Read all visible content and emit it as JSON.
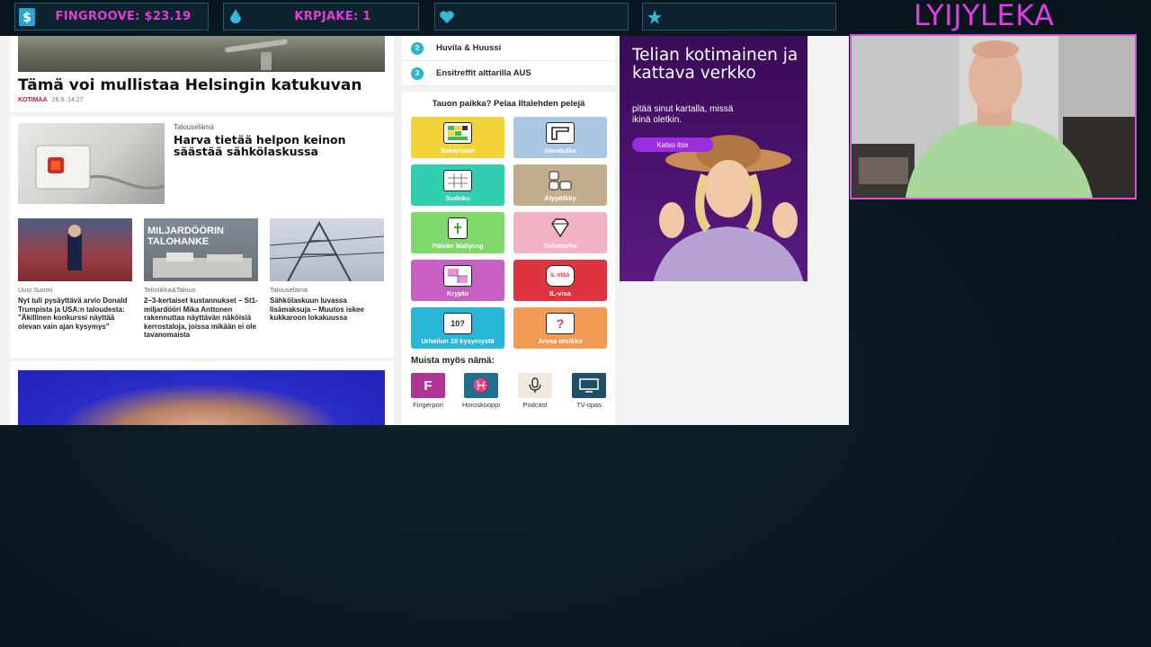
{
  "stream_bar": {
    "streamer_name": "LYIJYLEKA",
    "stats": [
      {
        "icon": "dollar-icon",
        "text": "FINGROOVE: $23.19"
      },
      {
        "icon": "droplet-icon",
        "text": "KRPJAKE: 1"
      },
      {
        "icon": "heart-icon",
        "text": ""
      },
      {
        "icon": "star-icon",
        "text": ""
      }
    ],
    "accent_color": "#e63bd8"
  },
  "news": {
    "hero": {
      "title": "Tämä voi mullistaa Helsingin katukuvan",
      "tag": "KOTIMAA",
      "time": "26.8. 14:27"
    },
    "feature": {
      "category": "Talouselämä",
      "title": "Harva tietää helpon keinon säästää sähkölaskussa"
    },
    "small_stories": [
      {
        "category": "Uusi Suomi",
        "title": "Nyt tuli pysäyttävä arvio Donald Trumpista ja USA:n taloudesta: \"Äkillinen konkurssi näyttää olevan vain ajan kysymys\""
      },
      {
        "category": "Tekniikka&Talous",
        "title": "2–3-kertaiset kustannukset – St1-miljardööri Mika Anttonen rakennuttaa näyttävän näköisiä kerrostaloja, joissa mikään ei ole tavanomaista",
        "image_text": "MILJARDÖÖRIN TALOHANKE"
      },
      {
        "category": "Talouselämä",
        "title": "Sähkölaskuun luvassa lisämaksuja – Muutos iskee kukkaroon lokakuussa"
      }
    ]
  },
  "toplist": [
    {
      "num": "2",
      "label": "Huvila & Huussi"
    },
    {
      "num": "3",
      "label": "Ensitreffit alttarilla AUS"
    }
  ],
  "games": {
    "heading": "Tauon paikka? Pelaa Iltalehden pelejä",
    "tiles": [
      {
        "label": "Sanaristari",
        "color": "#f2d43a",
        "icon": "grid-icon",
        "glyph": ""
      },
      {
        "label": "Sanatutka",
        "color": "#a9c6e3",
        "icon": "ruler-icon",
        "glyph": ""
      },
      {
        "label": "Sudoku",
        "color": "#2fcfb0",
        "icon": "sudoku-icon",
        "glyph": ""
      },
      {
        "label": "Älypölkky",
        "color": "#c2ae8d",
        "icon": "blocks-icon",
        "glyph": ""
      },
      {
        "label": "Päivän Mahjong",
        "color": "#7ed96a",
        "icon": "mahjong-icon",
        "glyph": ""
      },
      {
        "label": "Taikatarha",
        "color": "#f3b2c4",
        "icon": "diamond-icon",
        "glyph": ""
      },
      {
        "label": "Krypto",
        "color": "#c85fc2",
        "icon": "crossword-icon",
        "glyph": ""
      },
      {
        "label": "IL-visa",
        "color": "#e03340",
        "icon": "quiz-bubble-icon",
        "glyph": "IL-VISA"
      },
      {
        "label": "Urheilun 10 kysymystä",
        "color": "#2ab6d9",
        "icon": "ten-questions-icon",
        "glyph": "10?"
      },
      {
        "label": "Arvaa otsikko",
        "color": "#f39a55",
        "icon": "question-mark-icon",
        "glyph": "?"
      }
    ],
    "remember_heading": "Muista myös nämä:",
    "mini_apps": [
      {
        "label": "Fingerpori",
        "color": "#b03597",
        "icon": "fingerpori-icon",
        "glyph": "F"
      },
      {
        "label": "Horoskooppi",
        "color": "#1f6f93",
        "icon": "pisces-icon",
        "glyph": "♓"
      },
      {
        "label": "Podcast",
        "color": "#efe8dc",
        "icon": "microphone-icon",
        "glyph": "🎙"
      },
      {
        "label": "TV-opas",
        "color": "#1e4f66",
        "icon": "tv-icon",
        "glyph": "▭"
      }
    ]
  },
  "ad": {
    "title": "Telian kotimainen ja kattava verkko",
    "subtitle": "pitää sinut kartalla, missä ikinä oletkin.",
    "cta": "Katso itse"
  }
}
